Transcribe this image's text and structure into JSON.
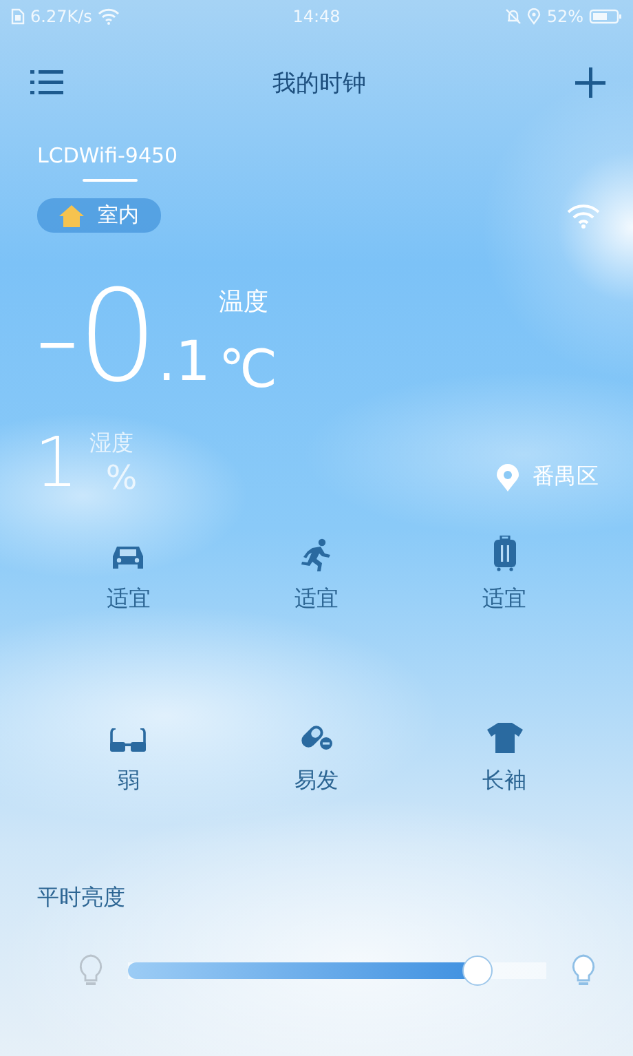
{
  "status_bar": {
    "speed": "6.27K/s",
    "time": "14:48",
    "battery": "52%"
  },
  "header": {
    "title": "我的时钟"
  },
  "device": {
    "name": "LCDWifi-9450",
    "room": "室内"
  },
  "temperature": {
    "label": "温度",
    "integer": "-0",
    "decimal": ".1",
    "unit": "℃"
  },
  "humidity": {
    "value": "1",
    "label": "湿度",
    "unit": "%"
  },
  "location": "番禺区",
  "indices": [
    {
      "kind": "car",
      "value": "适宜"
    },
    {
      "kind": "running",
      "value": "适宜"
    },
    {
      "kind": "luggage",
      "value": "适宜"
    },
    {
      "kind": "glasses",
      "value": "弱"
    },
    {
      "kind": "pill",
      "value": "易发"
    },
    {
      "kind": "shirt",
      "value": "长袖"
    }
  ],
  "brightness": {
    "label": "平时亮度",
    "level": 0.86
  }
}
